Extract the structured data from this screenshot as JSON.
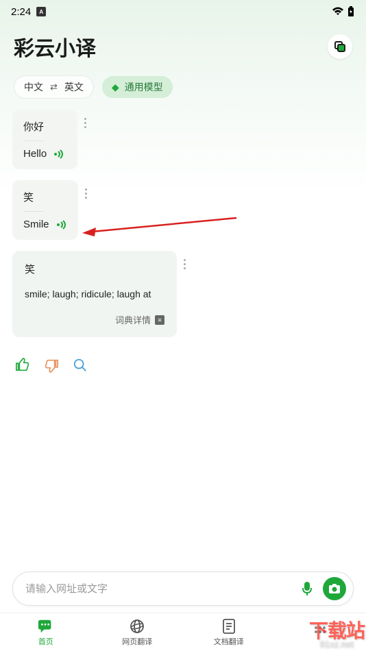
{
  "status": {
    "time": "2:24",
    "badge": "A"
  },
  "header": {
    "title": "彩云小译"
  },
  "lang": {
    "from": "中文",
    "to": "英文",
    "model": "通用模型"
  },
  "cards": [
    {
      "src": "你好",
      "result": "Hello"
    },
    {
      "src": "笑",
      "result": "Smile"
    }
  ],
  "dict": {
    "src": "笑",
    "result": "smile; laugh; ridicule; laugh at",
    "detail_label": "词典详情"
  },
  "input": {
    "placeholder": "请输入网址或文字"
  },
  "nav": [
    {
      "label": "首页"
    },
    {
      "label": "网页翻译"
    },
    {
      "label": "文档翻译"
    },
    {
      "label": ""
    }
  ],
  "watermark": {
    "top": "下载站",
    "bottom": "91xz.net"
  }
}
